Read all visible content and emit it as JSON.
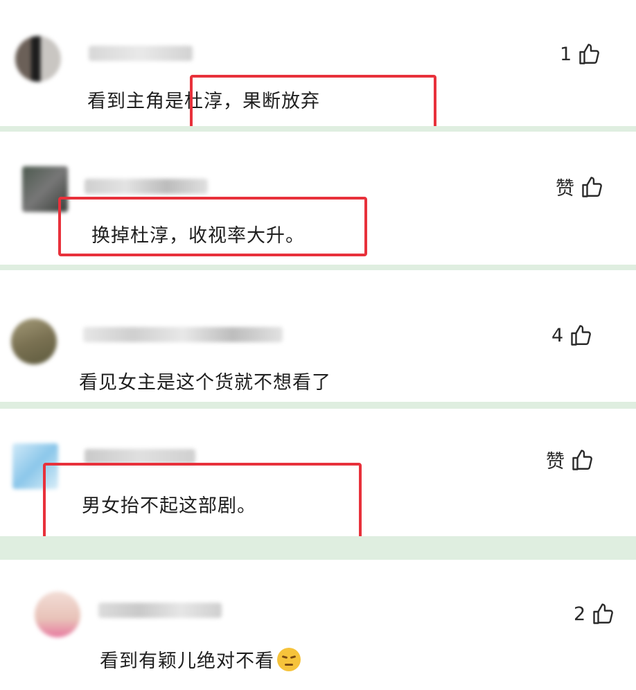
{
  "comments": [
    {
      "text": "看到主角是杜淳，果断放弃",
      "like_label": "1",
      "avatar_color": "#6b6058"
    },
    {
      "text": "换掉杜淳，收视率大升。",
      "like_label": "赞",
      "avatar_color": "#4d5a4f"
    },
    {
      "text": "看见女主是这个货就不想看了",
      "like_label": "4",
      "avatar_color": "#7a7152"
    },
    {
      "text": "男女抬不起这部剧。",
      "like_label": "赞",
      "avatar_color": "#8cc7ea"
    },
    {
      "text": "看到有颖儿绝对不看",
      "like_label": "2",
      "avatar_color": "#e8c2b8"
    }
  ],
  "colors": {
    "highlight_box": "#e8313b",
    "divider": "#dfeee0"
  }
}
